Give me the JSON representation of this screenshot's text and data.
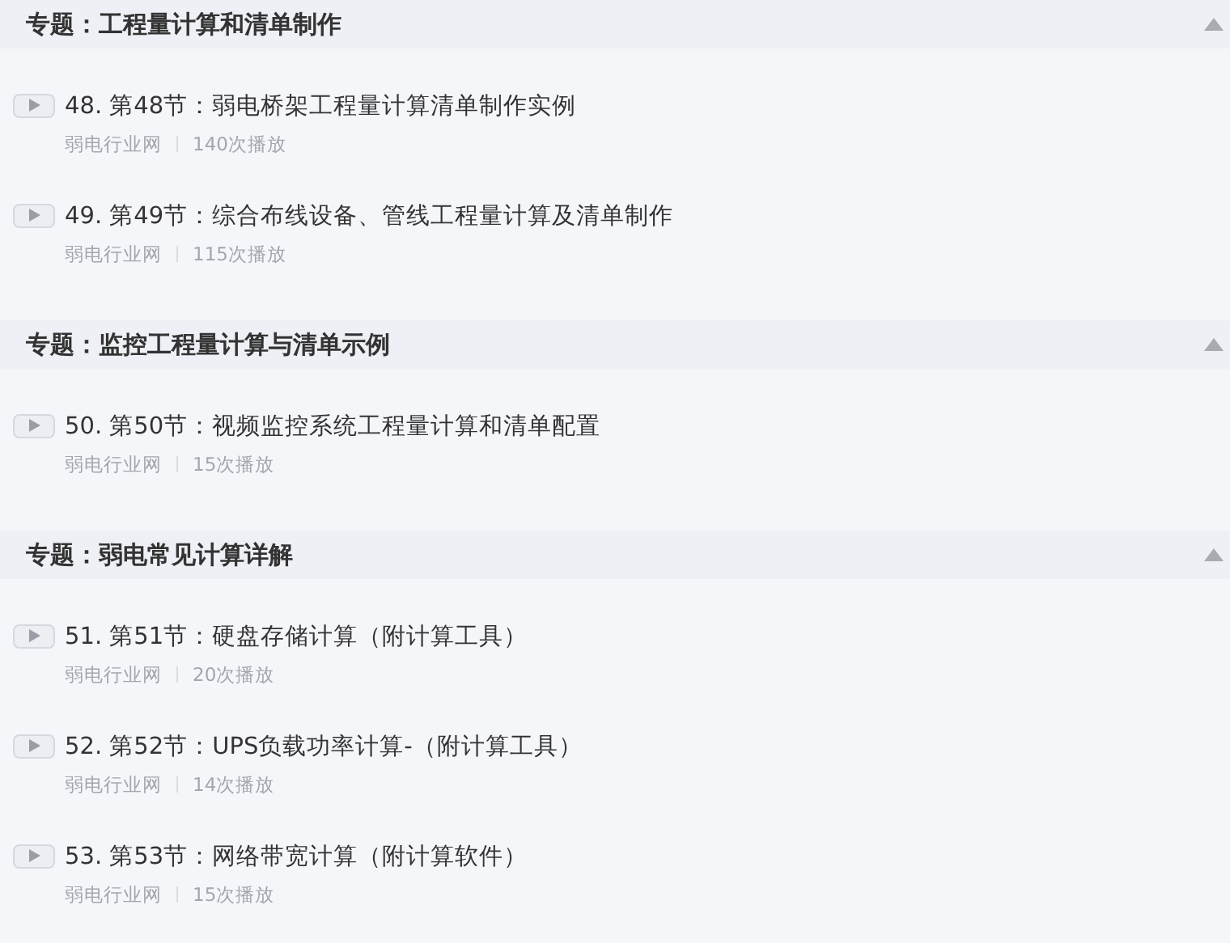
{
  "sections": [
    {
      "title": "专题：工程量计算和清单制作",
      "expanded": true,
      "lessons": [
        {
          "title": "48. 第48节：弱电桥架工程量计算清单制作实例",
          "author": "弱电行业网",
          "plays": "140次播放"
        },
        {
          "title": "49. 第49节：综合布线设备、管线工程量计算及清单制作",
          "author": "弱电行业网",
          "plays": "115次播放"
        }
      ]
    },
    {
      "title": "专题：监控工程量计算与清单示例",
      "expanded": true,
      "lessons": [
        {
          "title": "50. 第50节：视频监控系统工程量计算和清单配置",
          "author": "弱电行业网",
          "plays": "15次播放"
        }
      ]
    },
    {
      "title": "专题：弱电常见计算详解",
      "expanded": true,
      "lessons": [
        {
          "title": "51. 第51节：硬盘存储计算（附计算工具）",
          "author": "弱电行业网",
          "plays": "20次播放"
        },
        {
          "title": "52. 第52节：UPS负载功率计算-（附计算工具）",
          "author": "弱电行业网",
          "plays": "14次播放"
        },
        {
          "title": "53. 第53节：网络带宽计算（附计算软件）",
          "author": "弱电行业网",
          "plays": "15次播放"
        }
      ]
    }
  ]
}
